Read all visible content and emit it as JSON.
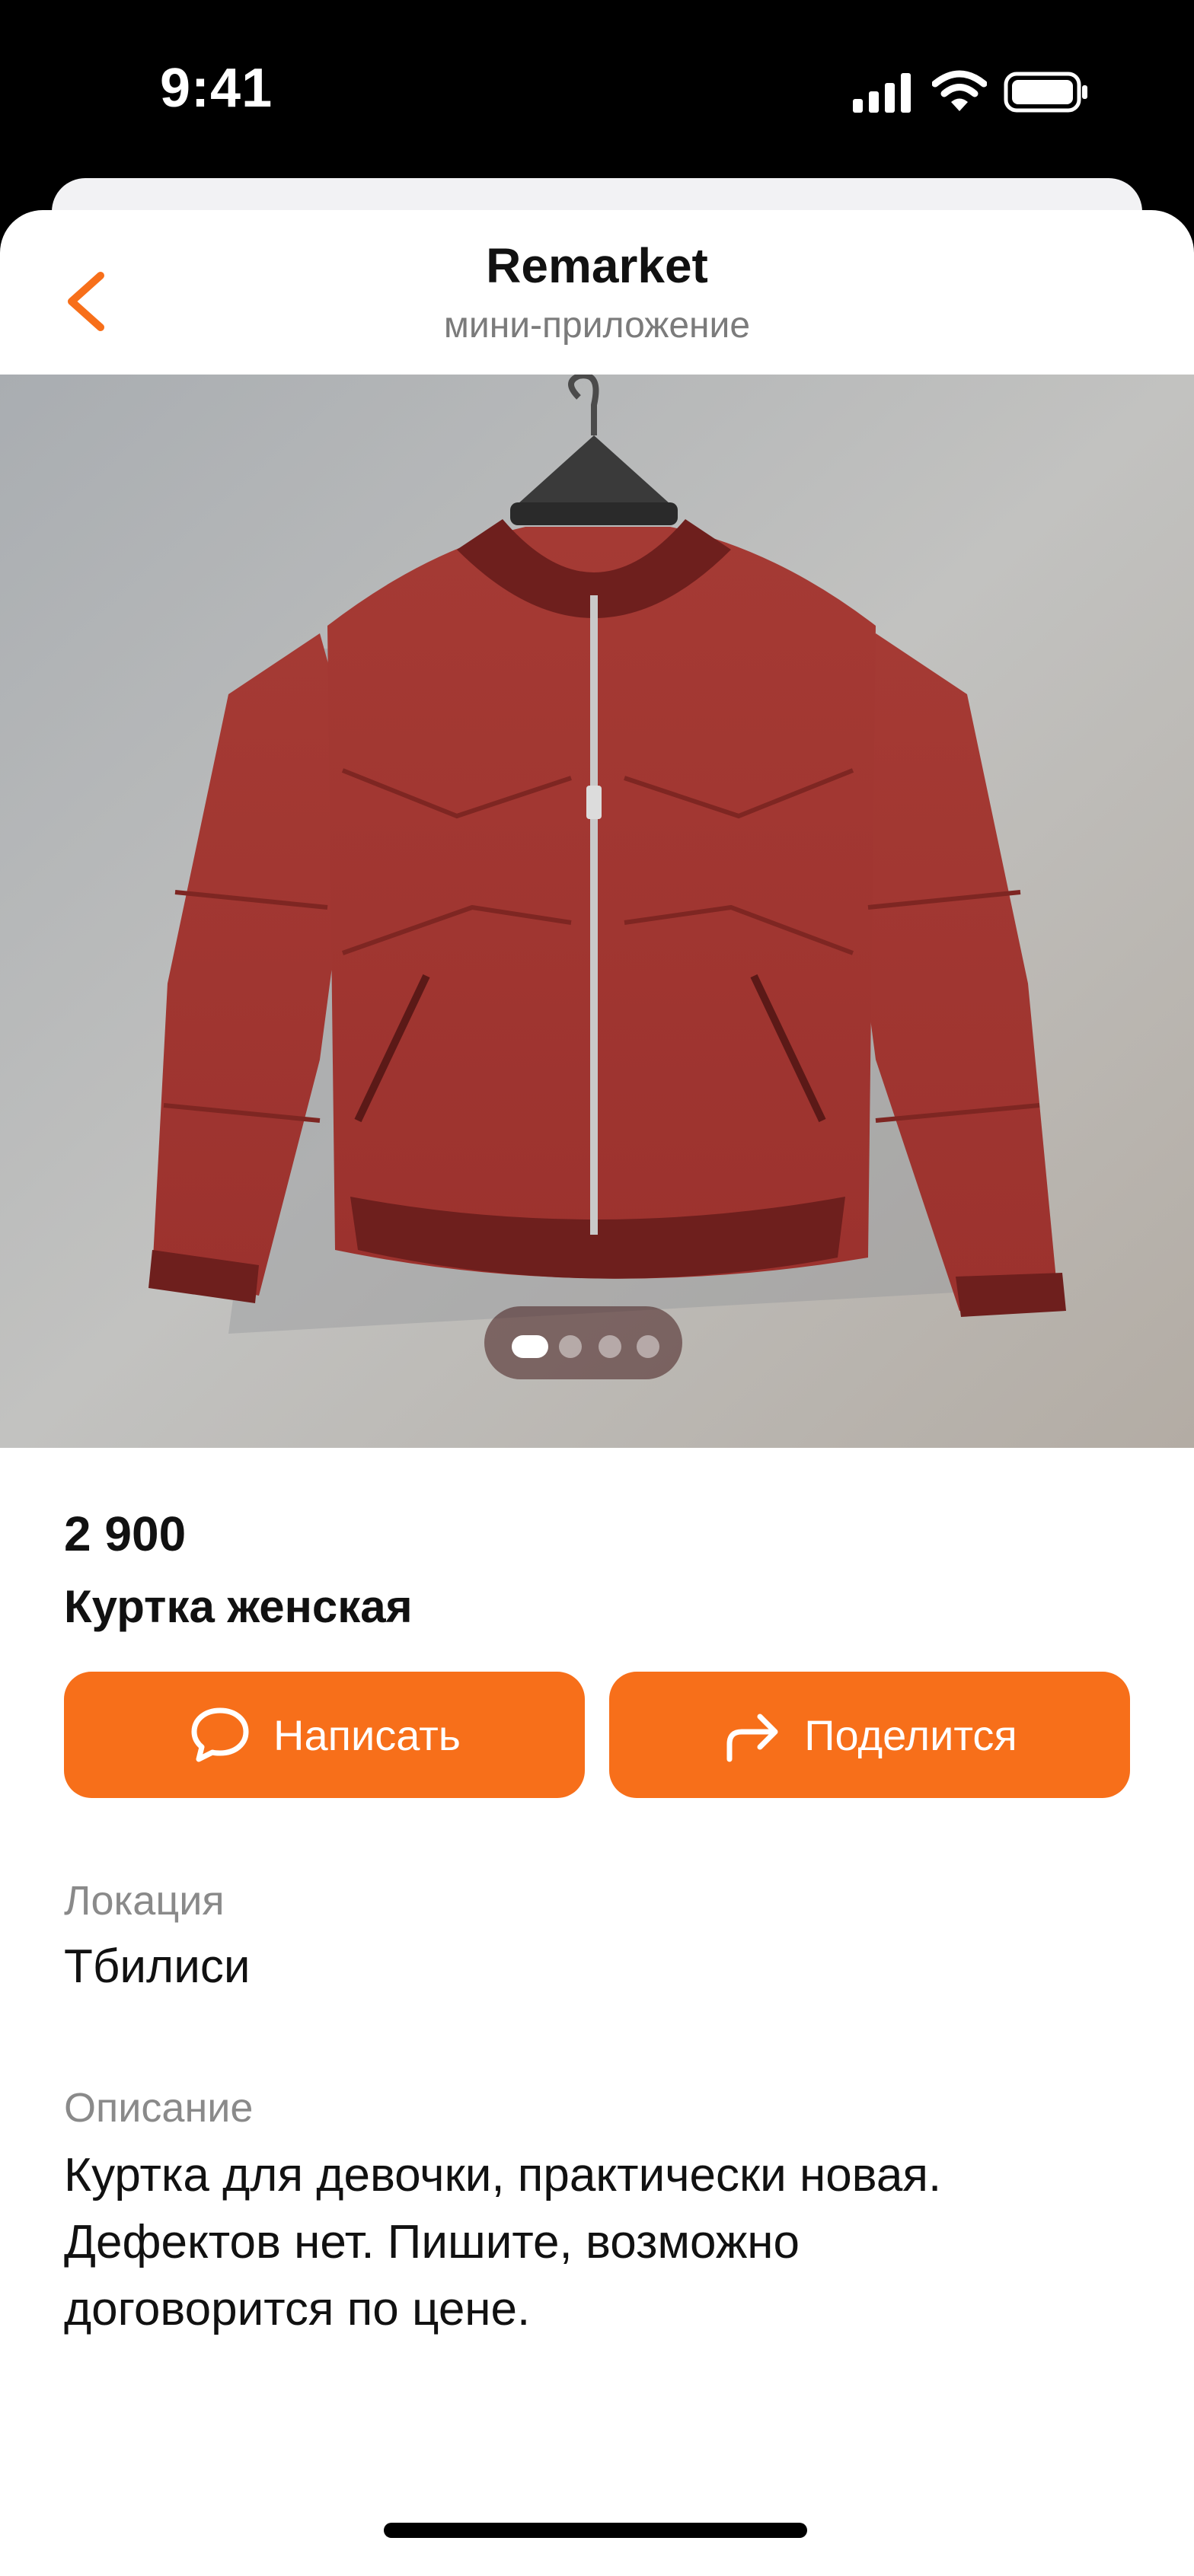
{
  "status_bar": {
    "time": "9:41"
  },
  "header": {
    "title": "Remarket",
    "subtitle": "мини-приложение"
  },
  "gallery": {
    "total_images": 4,
    "active_index": 1
  },
  "product": {
    "price": "2 900",
    "title": "Куртка женская"
  },
  "actions": {
    "write_label": "Написать",
    "share_label": "Поделится"
  },
  "details": {
    "location_label": "Локация",
    "location_value": "Тбилиси",
    "description_label": "Описание",
    "description_lines": [
      "Куртка для девочки, практически новая.",
      "Дефектов нет. Пишите, возможно",
      "договорится по цене."
    ]
  },
  "colors": {
    "accent": "#f76f1a",
    "muted_text": "#8a8a8a",
    "text": "#111111"
  }
}
